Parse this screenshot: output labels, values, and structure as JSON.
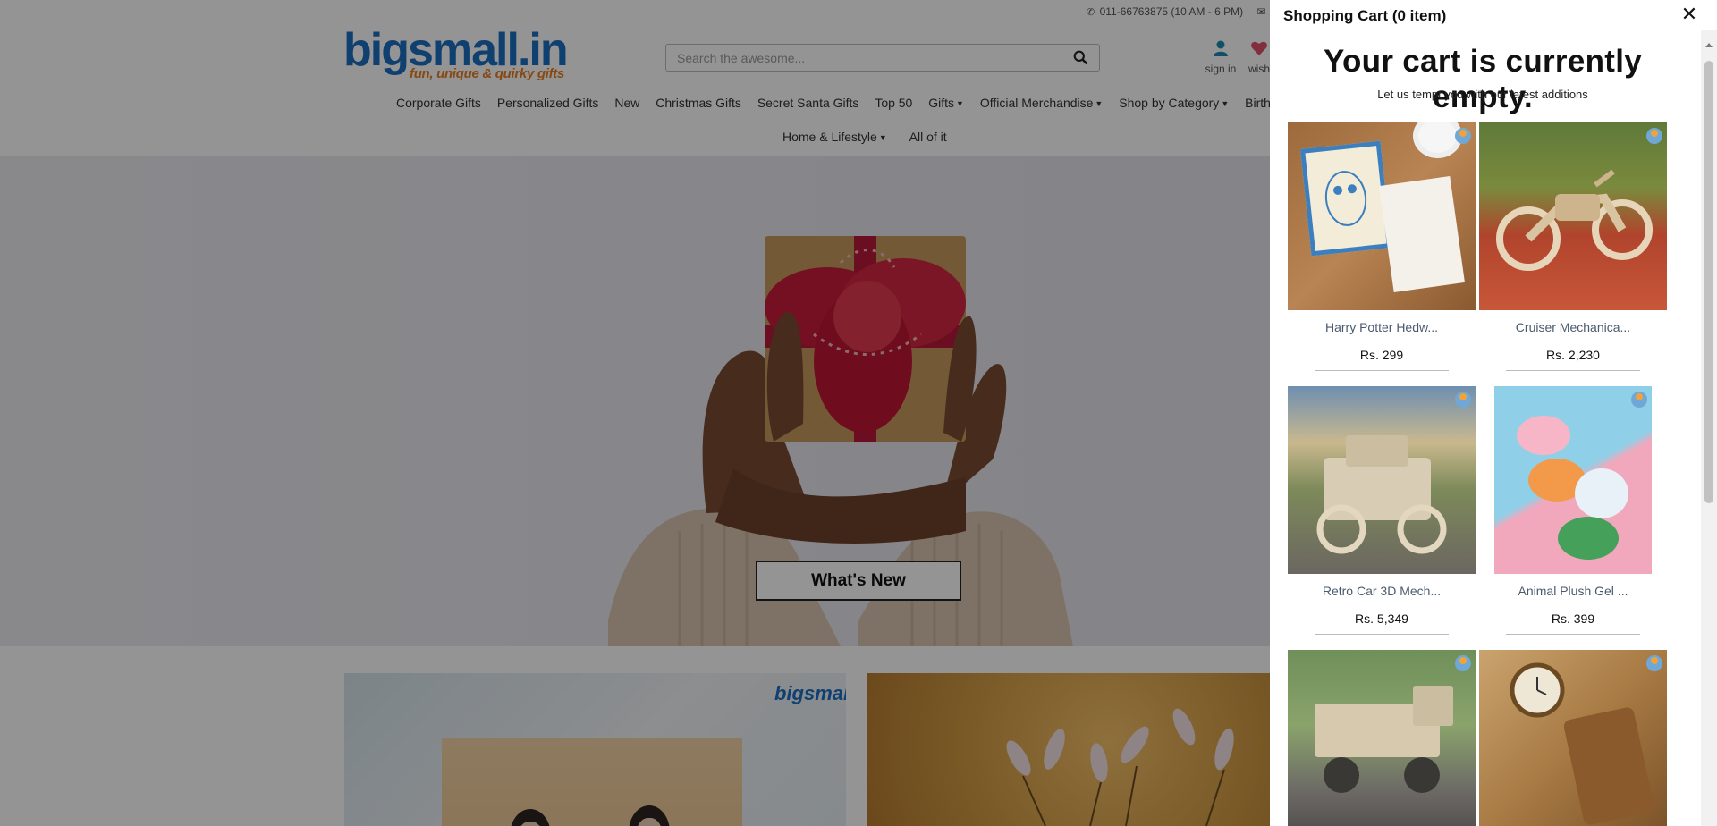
{
  "header": {
    "phone": "011-66763875 (10 AM - 6 PM)",
    "logo_main": "bigsmall.in",
    "logo_tagline": "fun, unique & quirky gifts",
    "search_placeholder": "Search the awesome...",
    "sign_in": "sign in",
    "wishlist": "wish",
    "nav": [
      {
        "label": "Corporate Gifts",
        "dropdown": false
      },
      {
        "label": "Personalized Gifts",
        "dropdown": false
      },
      {
        "label": "New",
        "dropdown": false
      },
      {
        "label": "Christmas Gifts",
        "dropdown": false
      },
      {
        "label": "Secret Santa Gifts",
        "dropdown": false
      },
      {
        "label": "Top 50",
        "dropdown": false
      },
      {
        "label": "Gifts",
        "dropdown": true
      },
      {
        "label": "Official Merchandise",
        "dropdown": true
      },
      {
        "label": "Shop by Category",
        "dropdown": true
      },
      {
        "label": "Birthda",
        "dropdown": false
      }
    ],
    "nav2": [
      {
        "label": "Home & Lifestyle",
        "dropdown": true
      },
      {
        "label": "All of it",
        "dropdown": false
      }
    ]
  },
  "hero": {
    "button_label": "What's New"
  },
  "promo": {
    "card1_brand": "bigsmall"
  },
  "cart": {
    "title": "Shopping Cart (0 item)",
    "close_glyph": "✕",
    "empty_heading": "Your cart is currently empty.",
    "empty_sub": "Let us tempt you with our latest additions",
    "items": [
      {
        "name": "Harry Potter Hedw...",
        "price": "Rs. 299"
      },
      {
        "name": "Cruiser Mechanica...",
        "price": "Rs. 2,230"
      },
      {
        "name": "Retro Car 3D Mech...",
        "price": "Rs. 5,349"
      },
      {
        "name": "Animal Plush Gel ...",
        "price": "Rs. 399"
      },
      {
        "name": "",
        "price": ""
      },
      {
        "name": "",
        "price": ""
      }
    ]
  },
  "colors": {
    "brand_blue": "#1d6fc1",
    "brand_orange": "#e87d1e",
    "item_name": "#4a5a6e"
  }
}
